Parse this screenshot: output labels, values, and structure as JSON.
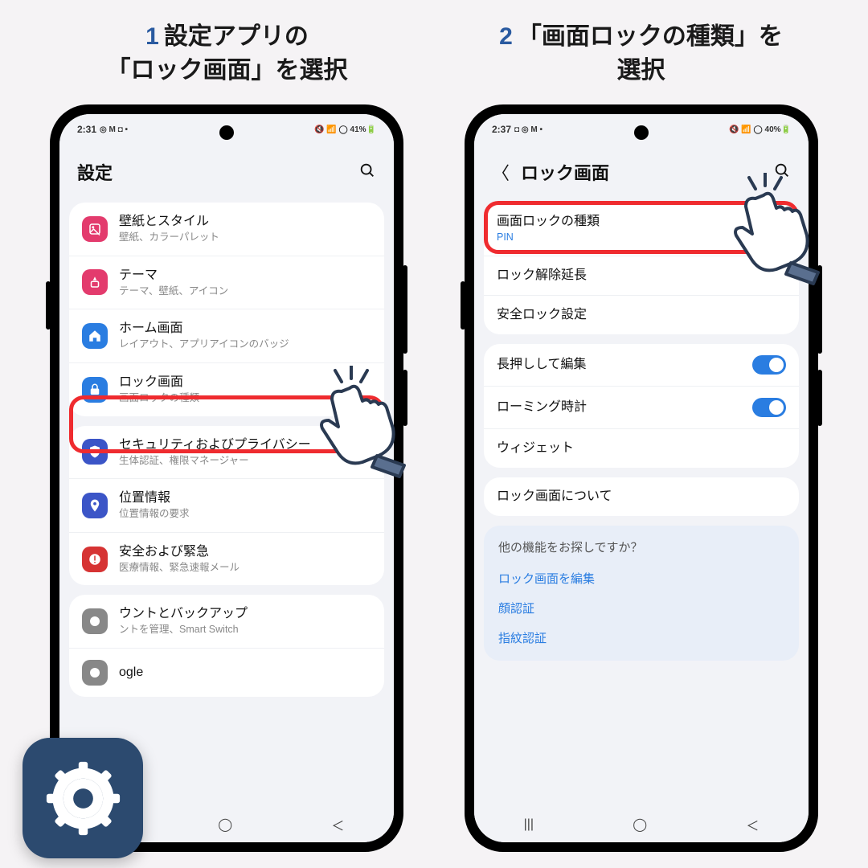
{
  "steps": {
    "s1": {
      "num": "1",
      "line1": "設定アプリの",
      "line2": "「ロック画面」を選択"
    },
    "s2": {
      "num": "2",
      "line1": "「画面ロックの種類」を",
      "line2": "選択"
    }
  },
  "colors": {
    "highlight": "#ef2b2f",
    "toggle_on": "#2a7de1",
    "link_blue": "#2a7de1"
  },
  "phone1": {
    "status": {
      "time": "2:31",
      "left_icons": "◎ M ◘ •",
      "right": "🔇 📶 ◯ 41%🔋"
    },
    "header_title": "設定",
    "groups": [
      {
        "rows": [
          {
            "icon_bg": "#e33b6d",
            "icon": "image-icon",
            "title": "壁紙とスタイル",
            "sub": "壁紙、カラーパレット"
          },
          {
            "icon_bg": "#e33b6d",
            "icon": "theme-icon",
            "title": "テーマ",
            "sub": "テーマ、壁紙、アイコン"
          },
          {
            "icon_bg": "#2a7de1",
            "icon": "home-icon",
            "title": "ホーム画面",
            "sub": "レイアウト、アプリアイコンのバッジ"
          },
          {
            "icon_bg": "#2a7de1",
            "icon": "lock-icon",
            "title": "ロック画面",
            "sub": "画面ロックの種類",
            "highlighted": true
          }
        ]
      },
      {
        "rows": [
          {
            "icon_bg": "#3b55c7",
            "icon": "shield-icon",
            "title": "セキュリティおよびプライバシー",
            "sub": "生体認証、権限マネージャー"
          },
          {
            "icon_bg": "#3b55c7",
            "icon": "location-icon",
            "title": "位置情報",
            "sub": "位置情報の要求"
          },
          {
            "icon_bg": "#d63333",
            "icon": "emergency-icon",
            "title": "安全および緊急",
            "sub": "医療情報、緊急速報メール"
          }
        ]
      },
      {
        "rows": [
          {
            "icon_bg": "#888",
            "icon": "account-icon",
            "title": "ウントとバックアップ",
            "sub": "ントを管理、Smart Switch"
          },
          {
            "icon_bg": "#888",
            "icon": "google-icon",
            "title": "ogle",
            "sub": ""
          }
        ]
      }
    ]
  },
  "phone2": {
    "status": {
      "time": "2:37",
      "left_icons": "◘ ◎ M •",
      "right": "🔇 📶 ◯ 40%🔋"
    },
    "header_title": "ロック画面",
    "groups": [
      {
        "rows": [
          {
            "title": "画面ロックの種類",
            "sub": "PIN",
            "sub_blue": true,
            "highlighted": true
          },
          {
            "title": "ロック解除延長"
          },
          {
            "title": "安全ロック設定"
          }
        ]
      },
      {
        "rows": [
          {
            "title": "長押しして編集",
            "toggle": true
          },
          {
            "title": "ローミング時計",
            "toggle": true
          },
          {
            "title": "ウィジェット"
          }
        ]
      },
      {
        "rows": [
          {
            "title": "ロック画面について"
          }
        ]
      }
    ],
    "also": {
      "heading": "他の機能をお探しですか？",
      "links": [
        "ロック画面を編集",
        "顔認証",
        "指紋認証"
      ]
    }
  },
  "nav": {
    "recent": "|||",
    "home": "◯",
    "back": "＜"
  }
}
